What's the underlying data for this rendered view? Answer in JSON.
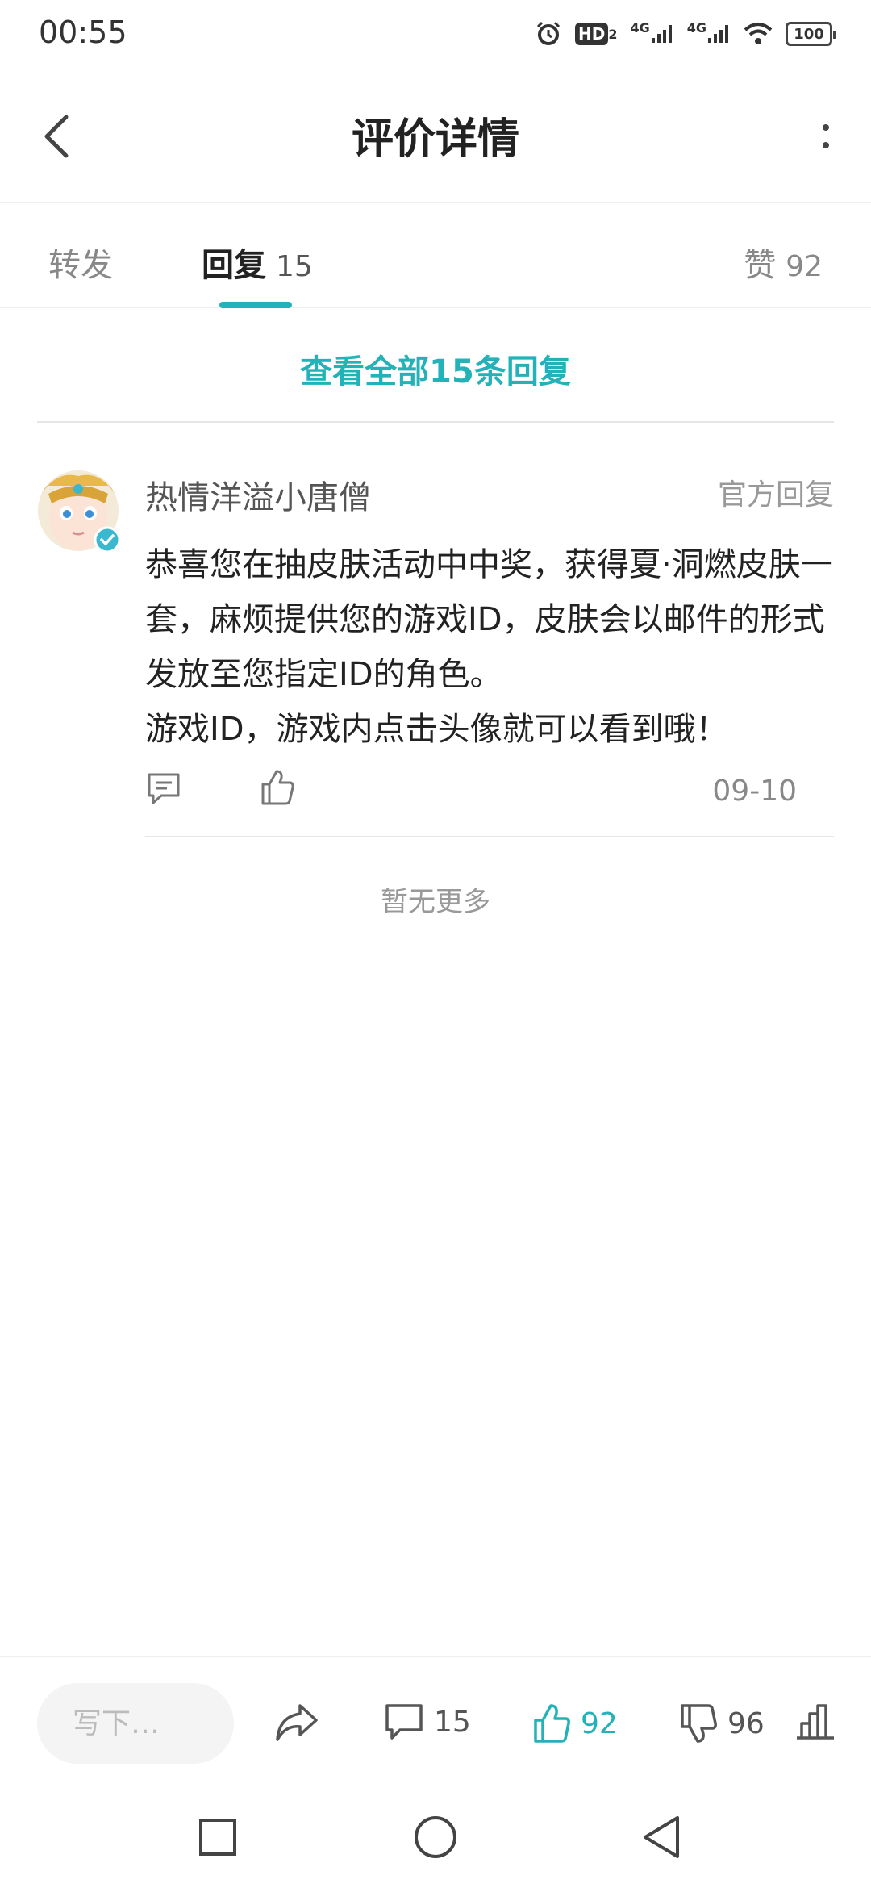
{
  "status_bar": {
    "time": "00:55",
    "hd_label": "HD",
    "network1": "4G",
    "network2": "4G",
    "battery": "100"
  },
  "header": {
    "title": "评价详情"
  },
  "tabs": {
    "forward_label": "转发",
    "reply_label": "回复",
    "reply_count": "15",
    "like_label": "赞",
    "like_count": "92"
  },
  "view_all_label": "查看全部15条回复",
  "reply": {
    "user_name": "热情洋溢小唐僧",
    "tag": "官方回复",
    "body_line1": "恭喜您在抽皮肤活动中中奖，获得夏·洞燃皮肤一套，麻烦提供您的游戏ID，皮肤会以邮件的形式发放至您指定ID的角色。",
    "body_line2": "游戏ID，游戏内点击头像就可以看到哦！",
    "date": "09-10"
  },
  "no_more_label": "暂无更多",
  "bottom_bar": {
    "input_placeholder": "写下…",
    "comment_count": "15",
    "like_count": "92",
    "dislike_count": "96"
  },
  "colors": {
    "accent": "#22b2b8"
  }
}
